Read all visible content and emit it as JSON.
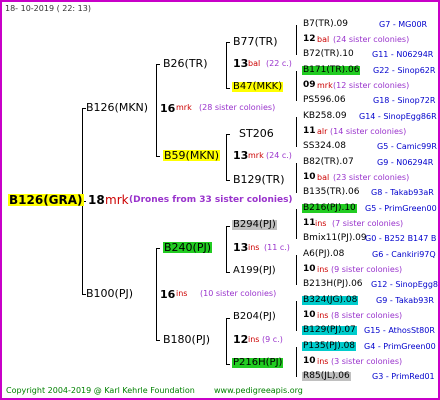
{
  "header": {
    "date": "18-  10-2019  ( 22:  13)",
    "date_color": "#333333"
  },
  "footer": {
    "copyright": "Copyright 2004-2019 @ Karl Kehrle Foundation",
    "site": "www.pedigreeapis.org",
    "color": "#008000"
  },
  "colors": {
    "yellow": "#ffff00",
    "green": "#22cc22",
    "cyan": "#00cccc",
    "gray": "#c0c0c0",
    "border": "#c800c8",
    "red": "#cc0000",
    "blue": "#0000cc",
    "purple": "#9933cc"
  },
  "root": {
    "name": "B126(GRA)",
    "count": "18",
    "suffix": "mrk",
    "note": "(Drones from 33 sister colonies)"
  },
  "gen1": [
    {
      "name": "B126(MKN)",
      "count": "16",
      "suffix": "mrk",
      "note": "(28 sister colonies)"
    },
    {
      "name": "B100(PJ)",
      "count": "16",
      "suffix": "ins",
      "note": "(10 sister colonies)"
    }
  ],
  "gen2": [
    {
      "name": "B26(TR)"
    },
    {
      "name": "B59(MKN)"
    },
    {
      "name": "B240(PJ)"
    },
    {
      "name": "B180(PJ)"
    }
  ],
  "gen3": [
    {
      "name": "B77(TR)",
      "count": "13",
      "suffix": "bal",
      "note": "(22 c.)"
    },
    {
      "name": "B47(MKK)"
    },
    {
      "name": "ST206",
      "count": "13",
      "suffix": "mrk",
      "note": "(24 c.)"
    },
    {
      "name": "B129(TR)"
    },
    {
      "name": "B294(PJ)",
      "count": "13",
      "suffix": "ins",
      "note": "(11 c.)"
    },
    {
      "name": "A199(PJ)"
    },
    {
      "name": "B204(PJ)",
      "count": "12",
      "suffix": "ins",
      "note": "(9 c.)"
    },
    {
      "name": "P216H(PJ)"
    }
  ],
  "gen4": [
    {
      "name": "B7(TR).09",
      "note": "G7 - MG00R"
    },
    {
      "count": "12",
      "suffix": "bal",
      "text": "(24 sister colonies)"
    },
    {
      "name": "B72(TR).10",
      "note": "G11 - N06294R"
    },
    {
      "name": "B171(TR).06",
      "note": "G22 - Sinop62R"
    },
    {
      "count": "09",
      "suffix": "mrk",
      "text": "(12 sister colonies)"
    },
    {
      "name": "PS596.06",
      "note": "G18 - Sinop72R"
    },
    {
      "name": "KB258.09",
      "note": "G14 - SinopEgg86R"
    },
    {
      "count": "11",
      "suffix": "alr",
      "text": "(14 sister colonies)"
    },
    {
      "name": "SS324.08",
      "note": "G5 - Camic99R"
    },
    {
      "name": "B82(TR).07",
      "note": "G9 - N06294R"
    },
    {
      "count": "10",
      "suffix": "bal",
      "text": "(23 sister colonies)"
    },
    {
      "name": "B135(TR).06",
      "note": "G8 - Takab93aR"
    },
    {
      "name": "B216(PJ).10",
      "note": "G5 - PrimGreen00"
    },
    {
      "count": "11",
      "suffix": "ins",
      "text": "(7 sister colonies)"
    },
    {
      "name": "Bmix11(PJ).09",
      "note": "G0 - B252 B147 B"
    },
    {
      "name": "A6(PJ).08",
      "note": "G6 - Cankiri97Q"
    },
    {
      "count": "10",
      "suffix": "ins",
      "text": "(9 sister colonies)"
    },
    {
      "name": "B213H(PJ).06",
      "note": "G12 - SinopEgg86R"
    },
    {
      "name": "B324(JG).08",
      "note": "G9 - Takab93R"
    },
    {
      "count": "10",
      "suffix": "ins",
      "text": "(8 sister colonies)"
    },
    {
      "name": "B129(PJ).07",
      "note": "G15 - AthosSt80R"
    },
    {
      "name": "P135(PJ).08",
      "note": "G4 - PrimGreen00"
    },
    {
      "count": "10",
      "suffix": "ins",
      "text": "(3 sister colonies)"
    },
    {
      "name": "R85(JL).06",
      "note": "G3 - PrimRed01"
    }
  ]
}
